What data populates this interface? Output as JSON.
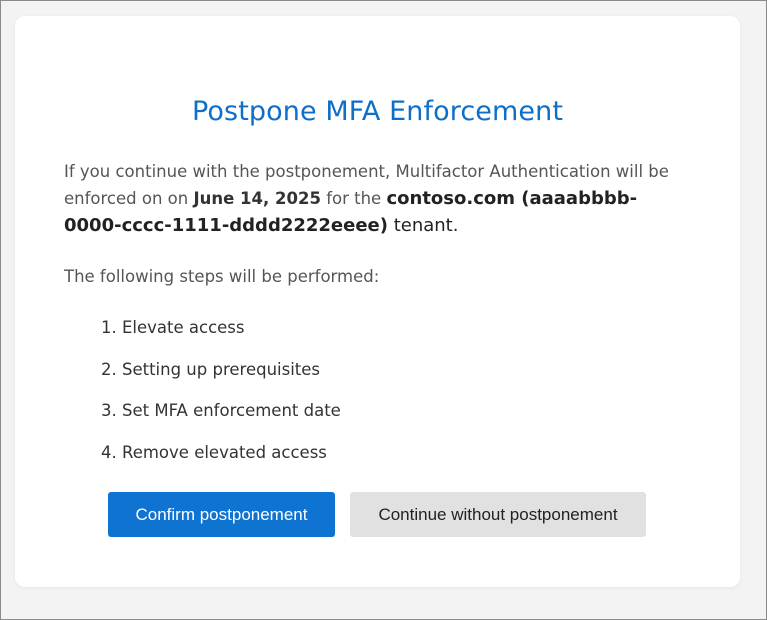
{
  "dialog": {
    "title": "Postpone MFA Enforcement",
    "intro": {
      "part1": "If you continue with the postponement, Multifactor Authentication will be enforced on on ",
      "date": "June 14, 2025",
      "part2": " for the ",
      "tenant": "contoso.com (aaaabbbb-0000-cccc-1111-dddd2222eeee)",
      "part3": " tenant."
    },
    "steps_heading": "The following steps will be performed:",
    "steps": [
      "1. Elevate access",
      "2. Setting up prerequisites",
      "3. Set MFA enforcement date",
      "4. Remove elevated access"
    ],
    "buttons": {
      "confirm_label": "Confirm postponement",
      "continue_label": "Continue without postponement"
    }
  },
  "colors": {
    "accent": "#0e6fc9",
    "primary_button": "#0e73d1",
    "secondary_button": "#e2e1e1",
    "background": "#f3f3f3"
  }
}
